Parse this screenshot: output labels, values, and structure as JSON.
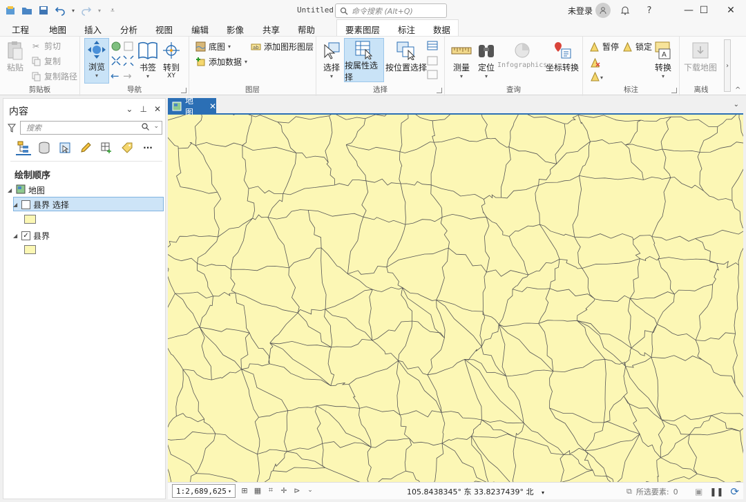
{
  "titlebar": {
    "title": "Untitled",
    "command_search_placeholder": "命令搜索 (Alt+Q)",
    "login": "未登录"
  },
  "tabs": [
    "工程",
    "地图",
    "插入",
    "分析",
    "视图",
    "编辑",
    "影像",
    "共享",
    "帮助"
  ],
  "active_tab": "地图",
  "context_tabs": [
    "要素图层",
    "标注",
    "数据"
  ],
  "ribbon": {
    "clipboard": {
      "label": "剪贴板",
      "paste": "粘贴",
      "cut": "剪切",
      "copy": "复制",
      "copy_path": "复制路径"
    },
    "navigate": {
      "label": "导航",
      "explore": "浏览",
      "bookmarks": "书签",
      "goto_xy": "转到",
      "goto_xy_sub": "XY"
    },
    "layer": {
      "label": "图层",
      "basemap": "底图",
      "add_data": "添加数据",
      "add_graphics_layer": "添加图形图层"
    },
    "selection": {
      "label": "选择",
      "select": "选择",
      "select_by_attributes": "按属性选择",
      "select_by_location": "按位置选择"
    },
    "inquiry": {
      "label": "查询",
      "measure": "测量",
      "locate": "定位",
      "infographics": "Infographics",
      "convert_coordinates": "坐标转换"
    },
    "labeling": {
      "label": "标注",
      "pause": "暂停",
      "lock": "锁定",
      "convert": "转换"
    },
    "offline": {
      "label": "离线",
      "download_map": "下载地图"
    }
  },
  "contents": {
    "title": "内容",
    "search_placeholder": "搜索",
    "drawing_order": "绘制顺序",
    "map_node": "地图",
    "layers": [
      {
        "name": "县界 选择",
        "checked": false,
        "selected": true,
        "fill": "#fbf7b4"
      },
      {
        "name": "县界",
        "checked": true,
        "selected": false,
        "fill": "#fbf7b4"
      }
    ]
  },
  "map_tab": {
    "label": "地图"
  },
  "map": {
    "fill": "#fcf7b5",
    "boundary_color": "#555555"
  },
  "status": {
    "scale": "1:2,689,625",
    "coords": "105.8438345° 东  33.8237439° 北",
    "selected_features_label": "所选要素:",
    "selected_features_count": "0"
  }
}
